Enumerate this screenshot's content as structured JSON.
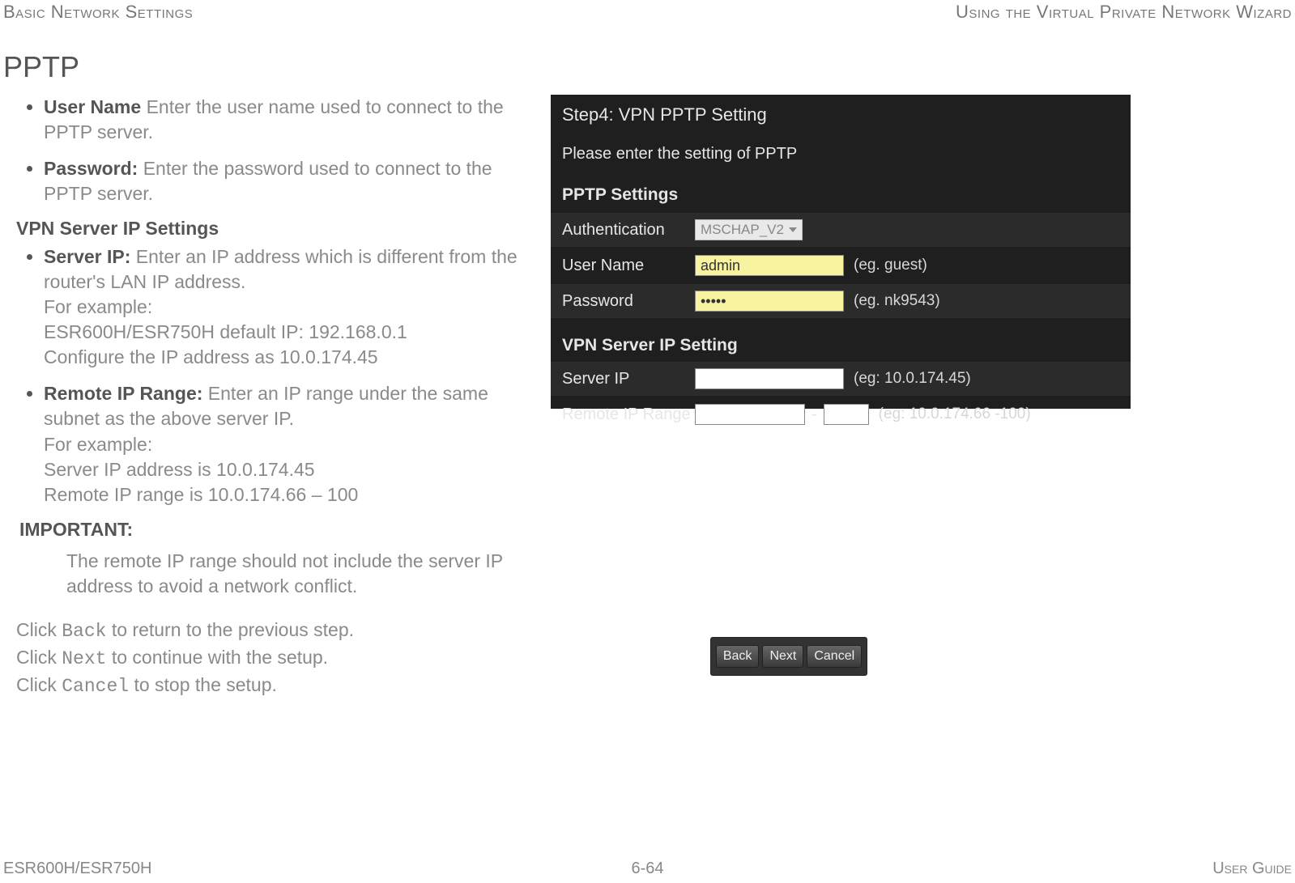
{
  "header": {
    "left": "Basic Network Settings",
    "right": "Using the Virtual Private Network Wizard"
  },
  "section_title": "PPTP",
  "bullets": {
    "username": {
      "term": "User Name",
      "desc": "  Enter the user name used to connect to the PPTP server."
    },
    "password": {
      "term": "Password:",
      "desc": " Enter the password used to connect to the PPTP server."
    },
    "vpn_subhead": "VPN Server IP Settings",
    "serverip": {
      "term": "Server IP:",
      "desc": " Enter an IP address which is different from the router's LAN IP address.",
      "l1": "For example:",
      "l2": "ESR600H/ESR750H default IP: 192.168.0.1",
      "l3": "Configure the IP address as 10.0.174.45"
    },
    "remote": {
      "term": "Remote IP Range:",
      "desc": " Enter an IP range under the same subnet as the above server IP.",
      "l1": "For example:",
      "l2": "Server IP address is 10.0.174.45",
      "l3": "Remote IP range is 10.0.174.66 – 100"
    }
  },
  "important": {
    "label": "IMPORTANT:",
    "text": "The remote IP range should not include the server IP address to avoid a network conflict."
  },
  "clicks": {
    "back_a": "Click ",
    "back_btn": "Back",
    "back_b": " to return to the previous step.",
    "next_a": "Click ",
    "next_btn": "Next",
    "next_b": " to continue with the setup.",
    "cancel_a": "Click ",
    "cancel_btn": "Cancel",
    "cancel_b": " to stop the setup."
  },
  "screenshot": {
    "step_title": "Step4: VPN PPTP Setting",
    "step_sub": "Please enter the setting of PPTP",
    "grp1": "PPTP Settings",
    "auth_label": "Authentication",
    "auth_value": "MSCHAP_V2",
    "user_label": "User Name",
    "user_value": "admin",
    "user_eg": "(eg. guest)",
    "pass_label": "Password",
    "pass_value": "•••••",
    "pass_eg": "(eg. nk9543)",
    "grp2": "VPN Server IP Setting",
    "sip_label": "Server IP",
    "sip_value": "",
    "sip_eg": "(eg: 10.0.174.45)",
    "rip_label": "Remote IP Range",
    "rip_value1": "",
    "rip_value2": "",
    "rip_eg": "(eg: 10.0.174.66 -100)"
  },
  "btnbar": {
    "back": "Back",
    "next": "Next",
    "cancel": "Cancel"
  },
  "footer": {
    "left": "ESR600H/ESR750H",
    "center": "6-64",
    "right": "User Guide"
  }
}
